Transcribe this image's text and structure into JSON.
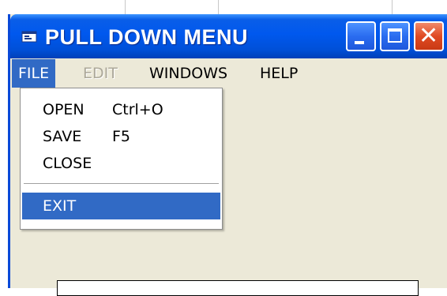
{
  "window": {
    "title": "PULL DOWN MENU"
  },
  "titlebar_buttons": {
    "minimize": "minimize-icon",
    "maximize": "maximize-icon",
    "close": "close-icon",
    "close_glyph": "✕"
  },
  "menubar": {
    "items": [
      {
        "label": "FILE",
        "state": "open"
      },
      {
        "label": "EDIT",
        "state": "disabled"
      },
      {
        "label": "WINDOWS",
        "state": "normal"
      },
      {
        "label": "HELP",
        "state": "normal"
      }
    ]
  },
  "file_menu": {
    "items": [
      {
        "label": "OPEN",
        "shortcut": "Ctrl+O"
      },
      {
        "label": "SAVE",
        "shortcut": "F5"
      },
      {
        "label": "CLOSE",
        "shortcut": ""
      },
      {
        "label": "EXIT",
        "shortcut": "",
        "selected": true
      }
    ]
  },
  "colors": {
    "titlebar": "#0058ee",
    "selection": "#316ac5",
    "window_body": "#ece9d8",
    "close_button": "#e04a23",
    "disabled_text": "#aca899"
  }
}
